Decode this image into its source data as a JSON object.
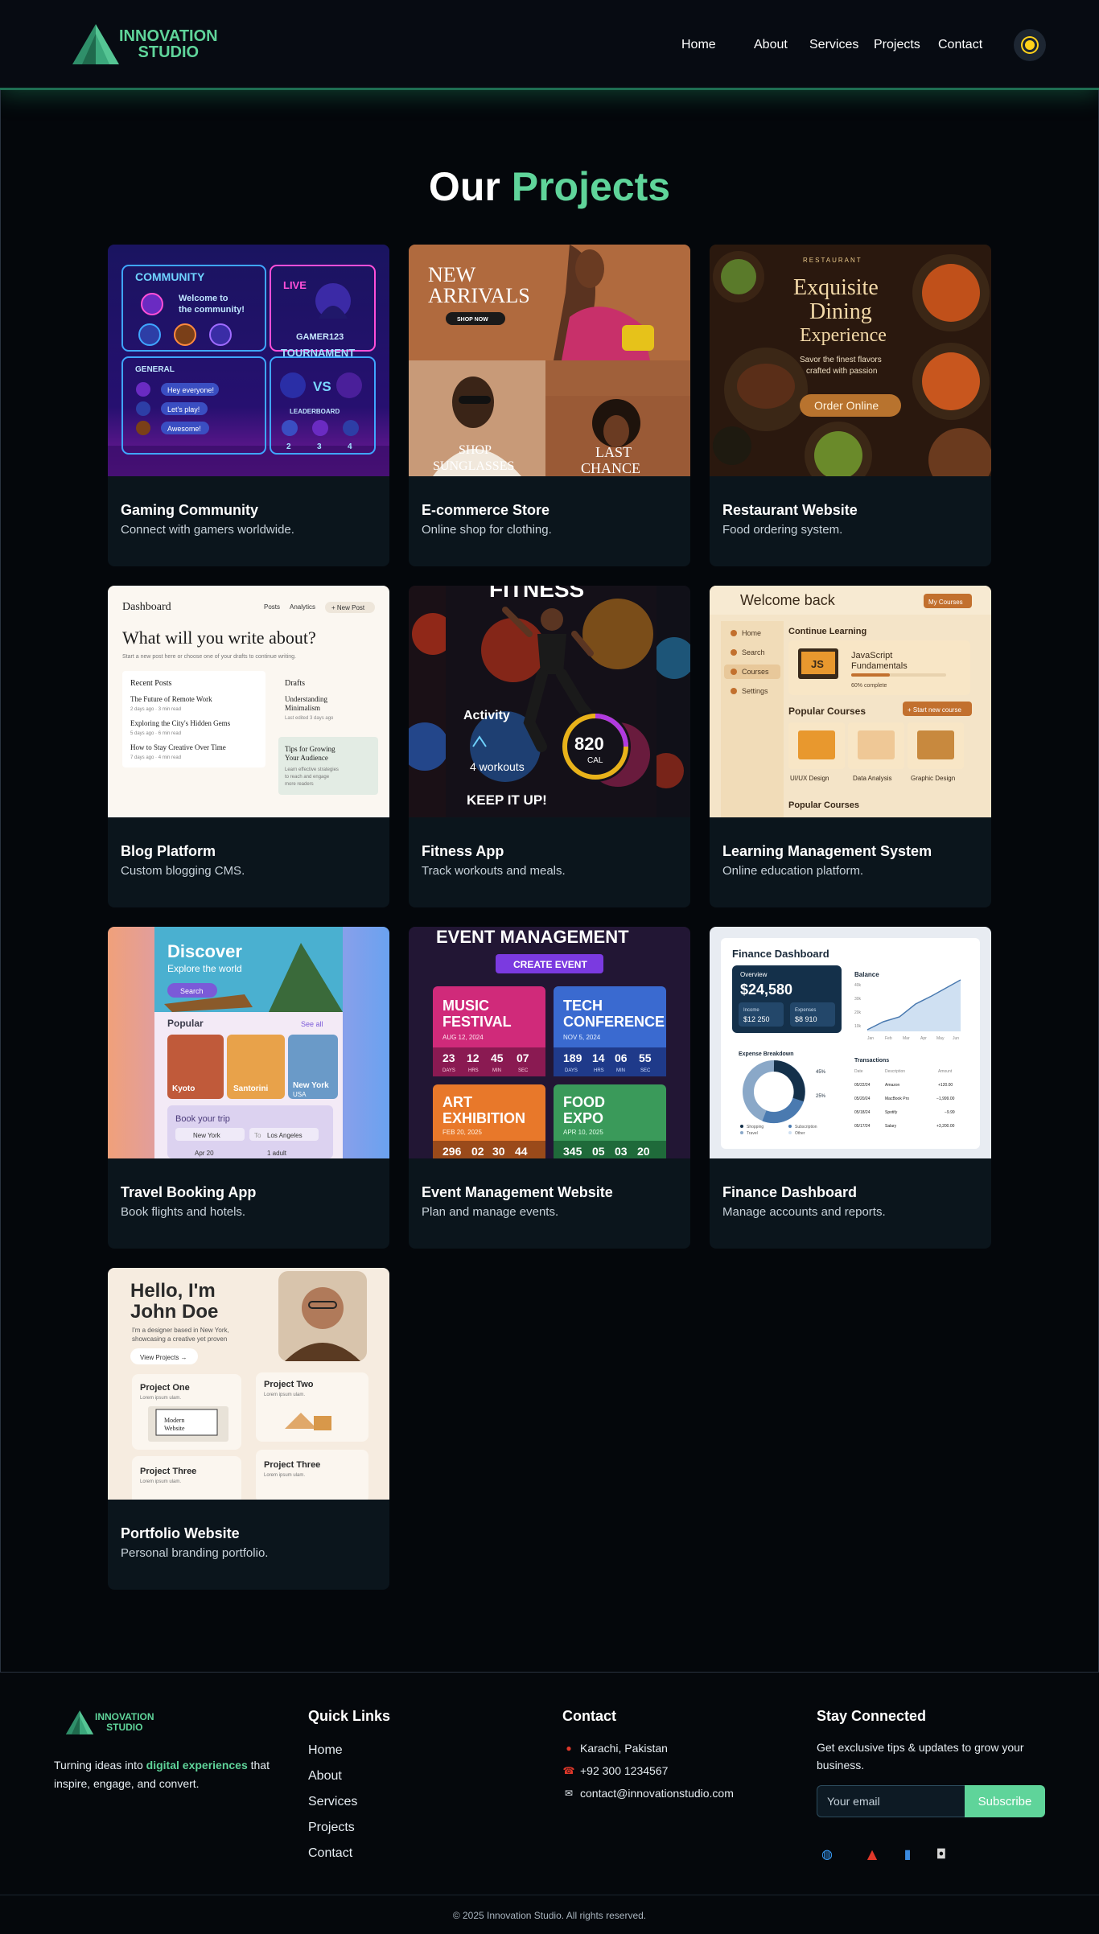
{
  "brand": {
    "line1": "INNOVATION",
    "line2": "STUDIO"
  },
  "nav": {
    "home": "Home",
    "about": "About",
    "services": "Services",
    "projects": "Projects",
    "contact": "Contact"
  },
  "theme_toggle_icon": "sun-icon",
  "section": {
    "title_part1": "Our",
    "title_part2": "Projects"
  },
  "projects": [
    {
      "title": "Gaming Community",
      "description": "Connect with gamers worldwide.",
      "image_text": {
        "community": "COMMUNITY",
        "welcome1": "Welcome to",
        "welcome2": "the community!",
        "live": "LIVE",
        "gamer": "GAMER123",
        "general": "GENERAL",
        "msg1": "Hey everyone!",
        "msg2": "Let's play!",
        "msg3": "Awesome!",
        "tournament": "TOURNAMENT",
        "vs": "VS",
        "leaderboard": "LEADERBOARD",
        "r2": "2",
        "r3": "3",
        "r4": "4"
      }
    },
    {
      "title": "E-commerce Store",
      "description": "Online shop for clothing.",
      "image_text": {
        "new": "NEW",
        "arrivals": "ARRIVALS",
        "shop_now": "SHOP NOW",
        "shop": "SHOP",
        "sunglasses": "SUNGLASSES",
        "last": "LAST",
        "chance": "CHANCE"
      }
    },
    {
      "title": "Restaurant Website",
      "description": "Food ordering system.",
      "image_text": {
        "restaurant": "RESTAURANT",
        "line1": "Exquisite",
        "line2": "Dining",
        "line3": "Experience",
        "sub1": "Savor the finest flavors",
        "sub2": "crafted with passion",
        "cta": "Order Online"
      }
    },
    {
      "title": "Blog Platform",
      "description": "Custom blogging CMS.",
      "image_text": {
        "dashboard": "Dashboard",
        "posts": "Posts",
        "analytics": "Analytics",
        "new_post": "+ New Post",
        "headline": "What will you write about?",
        "hint": "Start a new post here or choose one of your drafts to continue writing.",
        "recent": "Recent Posts",
        "p1": "The Future of Remote Work",
        "p1m": "2 days ago  ·  3 min read",
        "p2": "Exploring the City's Hidden Gems",
        "p2m": "5 days ago  ·  6 min read",
        "p3": "How to Stay Creative Over Time",
        "p3m": "7 days ago  ·  4 min read",
        "drafts": "Drafts",
        "d1a": "Understanding",
        "d1b": "Minimalism",
        "d1m": "Last edited 3 days ago",
        "tipa": "Tips for Growing",
        "tipb": "Your Audience",
        "tipc": "Learn effective strategies",
        "tipd": "to reach and engage",
        "tipe": "more readers"
      }
    },
    {
      "title": "Fitness App",
      "description": "Track workouts and meals.",
      "image_text": {
        "fitness": "FITNESS",
        "activity": "Activity",
        "workouts": "4 workouts",
        "cal_value": "820",
        "cal_unit": "CAL",
        "keep": "KEEP IT UP!"
      }
    },
    {
      "title": "Learning Management System",
      "description": "Online education platform.",
      "image_text": {
        "welcome": "Welcome back",
        "my_courses": "My Courses",
        "home": "Home",
        "search": "Search",
        "courses": "Courses",
        "settings": "Settings",
        "continue": "Continue Learning",
        "course1a": "JavaScript",
        "course1b": "Fundamentals",
        "js": "JS",
        "progress": "60% complete",
        "popular": "Popular Courses",
        "start_new": "+ Start new course",
        "c1": "UI/UX Design",
        "c2": "Data Analysis",
        "c3": "Graphic Design",
        "popular2": "Popular Courses"
      }
    },
    {
      "title": "Travel Booking App",
      "description": "Book flights and hotels.",
      "image_text": {
        "discover": "Discover",
        "explore": "Explore the world",
        "search": "Search",
        "popular": "Popular",
        "see_all": "See all",
        "d1": "Kyoto",
        "d2": "Santorini",
        "d3": "New York",
        "d3sub": "USA",
        "book": "Book your trip",
        "from": "New York",
        "to_label": "To",
        "to": "Los Angeles",
        "date": "Apr 20",
        "adults": "1 adult"
      }
    },
    {
      "title": "Event Management Website",
      "description": "Plan and manage events.",
      "image_text": {
        "header": "EVENT MANAGEMENT",
        "create": "CREATE EVENT",
        "e1a": "MUSIC",
        "e1b": "FESTIVAL",
        "e1d": "AUG 12, 2024",
        "e1c": [
          "23",
          "12",
          "45",
          "07"
        ],
        "e2a": "TECH",
        "e2b": "CONFERENCE",
        "e2d": "NOV 5, 2024",
        "e2c": [
          "189",
          "14",
          "06",
          "55"
        ],
        "e3a": "ART",
        "e3b": "EXHIBITION",
        "e3d": "FEB 20, 2025",
        "e3c": [
          "296",
          "02",
          "30",
          "44"
        ],
        "e4a": "FOOD",
        "e4b": "EXPO",
        "e4d": "APR 10, 2025",
        "e4c": [
          "345",
          "05",
          "03",
          "20"
        ],
        "units": [
          "DAYS",
          "HRS",
          "MIN",
          "SEC"
        ]
      }
    },
    {
      "title": "Finance Dashboard",
      "description": "Manage accounts and reports.",
      "image_text": {
        "title": "Finance Dashboard",
        "overview": "Overview",
        "balance_value": "$24,580",
        "income": "Income",
        "income_value": "$12 250",
        "expenses": "Expenses",
        "expenses_value": "$8 910",
        "balance": "Balance",
        "breakdown": "Expense Breakdown",
        "pct1": "45%",
        "pct2": "25%",
        "legend1": "Shopping",
        "legend2": "Subscription",
        "legend3": "Travel",
        "legend4": "Other",
        "transactions": "Transactions",
        "col_date": "Date",
        "col_desc": "Description",
        "col_amount": "Amount",
        "t1": [
          "05/22/24",
          "Amazon",
          "+120.00"
        ],
        "t2": [
          "05/20/24",
          "MacBook Pro",
          "−1,999.00"
        ],
        "t3": [
          "05/18/24",
          "Spotify",
          "−9.99"
        ],
        "t4": [
          "05/17/24",
          "Salary",
          "+3,200.00"
        ],
        "months": [
          "Jan",
          "Feb",
          "Mar",
          "Apr",
          "May",
          "Jun"
        ],
        "yticks": [
          "40k",
          "30k",
          "20k",
          "10k",
          "0"
        ]
      }
    },
    {
      "title": "Portfolio Website",
      "description": "Personal branding portfolio.",
      "image_text": {
        "hello1": "Hello, I'm",
        "hello2": "John Doe",
        "bio1": "I'm a designer based in New York,",
        "bio2": "showcasing a creative yet proven",
        "view": "View Projects →",
        "proj1": "Project One",
        "proj2": "Project Two",
        "proj3": "Project Three",
        "proj4": "Project Three",
        "lorem": "Lorem ipsum ulam.",
        "modern1": "Modern",
        "modern2": "Website"
      }
    }
  ],
  "footer": {
    "brand": {
      "line1": "INNOVATION",
      "line2": "STUDIO"
    },
    "tagline_prefix": "Turning ideas into ",
    "tagline_highlight": "digital experiences",
    "tagline_suffix": " that inspire, engage, and convert.",
    "quick_links_heading": "Quick Links",
    "quick_links": [
      "Home",
      "About",
      "Services",
      "Projects",
      "Contact"
    ],
    "contact_heading": "Contact",
    "address": "Karachi, Pakistan",
    "phone": "+92 300 1234567",
    "email": "contact@innovationstudio.com",
    "stay_heading": "Stay Connected",
    "stay_text": "Get exclusive tips & updates to grow your business.",
    "email_placeholder": "Your email",
    "subscribe_label": "Subscribe",
    "social_icons": [
      "globe-icon",
      "bird-icon",
      "book-icon",
      "camera-icon"
    ],
    "copyright": "© 2025 Innovation Studio. All rights reserved."
  },
  "colors": {
    "accent": "#5fd49a",
    "background": "#04070b",
    "card": "#0b151c"
  }
}
